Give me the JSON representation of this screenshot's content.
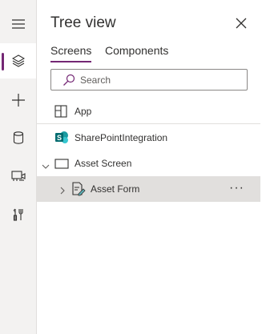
{
  "panel": {
    "title": "Tree view",
    "tabs": [
      {
        "label": "Screens",
        "active": true
      },
      {
        "label": "Components",
        "active": false
      }
    ],
    "search_placeholder": "Search"
  },
  "tree": {
    "app": {
      "label": "App",
      "icon": "app-icon"
    },
    "sharepoint": {
      "label": "SharePointIntegration",
      "icon": "sharepoint-icon"
    },
    "screen": {
      "label": "Asset Screen",
      "icon": "screen-icon",
      "expanded": true
    },
    "form": {
      "label": "Asset Form",
      "icon": "form-icon",
      "expanded": false,
      "selected": true,
      "more": "···"
    }
  },
  "rail": {
    "items": [
      "hamburger-menu-icon",
      "layers-icon",
      "add-icon",
      "data-icon",
      "media-icon",
      "tools-icon"
    ],
    "active": "layers-icon"
  },
  "colors": {
    "accent": "#742774",
    "sharepoint": "#036c70",
    "rail_bg": "#f3f2f1",
    "selected_row": "#e1dfdd"
  }
}
